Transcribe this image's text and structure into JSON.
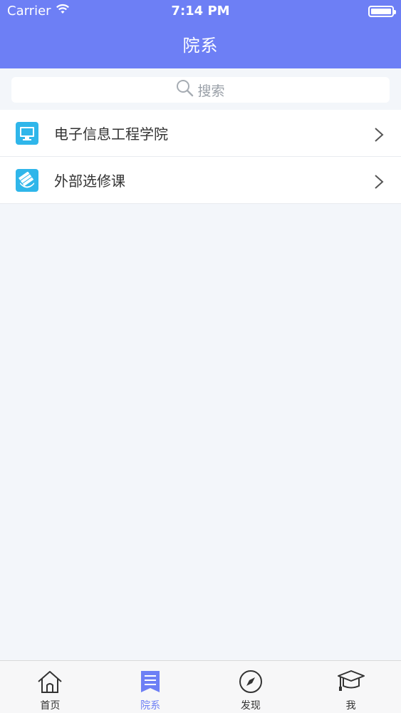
{
  "status": {
    "carrier": "Carrier",
    "time": "7:14 PM"
  },
  "header": {
    "title": "院系"
  },
  "search": {
    "placeholder": "搜索"
  },
  "list": {
    "items": [
      {
        "label": "电子信息工程学院",
        "icon": "monitor-icon"
      },
      {
        "label": "外部选修课",
        "icon": "book-stack-icon"
      }
    ]
  },
  "tabs": [
    {
      "label": "首页",
      "icon": "home-icon",
      "active": false
    },
    {
      "label": "院系",
      "icon": "list-icon",
      "active": true
    },
    {
      "label": "发现",
      "icon": "compass-icon",
      "active": false
    },
    {
      "label": "我",
      "icon": "graduation-cap-icon",
      "active": false
    }
  ],
  "colors": {
    "accent": "#6d7ff5",
    "icon_bg": "#2fb6ea",
    "background": "#f3f6fa"
  }
}
